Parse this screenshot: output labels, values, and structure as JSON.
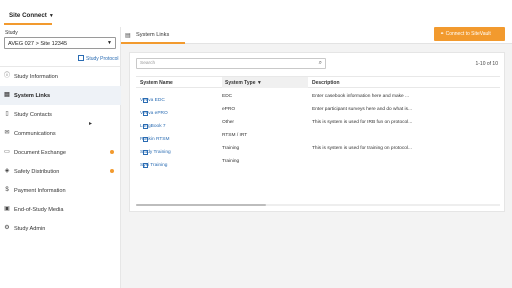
{
  "topbar": {
    "app_switcher": "Site Connect"
  },
  "sidebar": {
    "study_label": "Study",
    "study_value": "AVEG 027 > Site 12345",
    "protocol_link": "Study Protocol",
    "items": [
      {
        "label": "Study Information",
        "icon": "info-circle-icon",
        "active": false,
        "dot": false
      },
      {
        "label": "System Links",
        "icon": "grid-icon",
        "active": true,
        "dot": false
      },
      {
        "label": "Study Contacts",
        "icon": "person-icon",
        "active": false,
        "dot": false
      },
      {
        "label": "Communications",
        "icon": "megaphone-icon",
        "active": false,
        "dot": false
      },
      {
        "label": "Document Exchange",
        "icon": "document-icon",
        "active": false,
        "dot": true
      },
      {
        "label": "Safety Distribution",
        "icon": "shield-icon",
        "active": false,
        "dot": true
      },
      {
        "label": "Payment Information",
        "icon": "dollar-icon",
        "active": false,
        "dot": false
      },
      {
        "label": "End-of-Study Media",
        "icon": "media-icon",
        "active": false,
        "dot": false
      },
      {
        "label": "Study Admin",
        "icon": "gear-icon",
        "active": false,
        "dot": false
      }
    ]
  },
  "main": {
    "tab_label": "System Links",
    "connect_button": "Connect to SiteVault",
    "search_placeholder": "Search",
    "count": "1-10 of 10",
    "columns": [
      "System Name",
      "System Type",
      "Description"
    ],
    "rows": [
      {
        "name": "Veeva EDC",
        "type": "EDC",
        "description": "Enter casebook information here and make ..."
      },
      {
        "name": "Veeva ePRO",
        "type": "ePRO",
        "description": "Enter participant surveys here and do what is..."
      },
      {
        "name": "LongBook 7",
        "type": "Other",
        "description": "This is system is used for IRB fun on protocol..."
      },
      {
        "name": "Roskin RTSM",
        "type": "RTSM / IRT",
        "description": ""
      },
      {
        "name": "Study Training",
        "type": "Training",
        "description": "This is system is used for training on protocol..."
      },
      {
        "name": "Sysi Training",
        "type": "Training",
        "description": ""
      }
    ]
  },
  "colors": {
    "accent": "#f29a2e",
    "link": "#2a6cb3",
    "active_bg": "#eef2f7"
  }
}
